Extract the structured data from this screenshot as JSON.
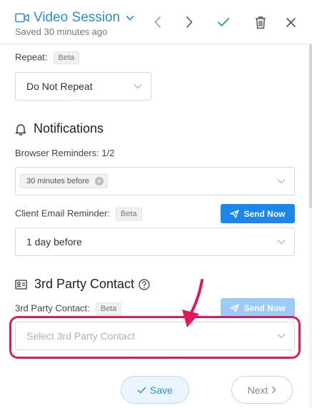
{
  "header": {
    "title": "Video Session",
    "subtitle": "Saved 30 minutes ago",
    "icons": [
      "video-camera-icon",
      "chevron-down-icon",
      "chevron-left-icon",
      "chevron-right-icon",
      "check-icon",
      "trash-icon",
      "close-icon"
    ]
  },
  "repeat": {
    "label": "Repeat:",
    "badge": "Beta",
    "value": "Do Not Repeat"
  },
  "notifications": {
    "title": "Notifications",
    "browser_reminders_label": "Browser Reminders: 1/2",
    "browser_reminder_tag": "30 minutes before",
    "client_email_label": "Client Email Reminder:",
    "client_email_badge": "Beta",
    "send_now": "Send Now",
    "client_email_value": "1 day before"
  },
  "third_party": {
    "title": "3rd Party Contact",
    "label": "3rd Party Contact:",
    "badge": "Beta",
    "send_now": "Send Now",
    "placeholder": "Select 3rd Party Contact"
  },
  "footer": {
    "save": "Save",
    "next": "Next"
  },
  "colors": {
    "accent": "#2a8dd8",
    "primary_button": "#1a87f0",
    "disabled_button": "#9ccbf6",
    "highlight": "#e2185f"
  }
}
